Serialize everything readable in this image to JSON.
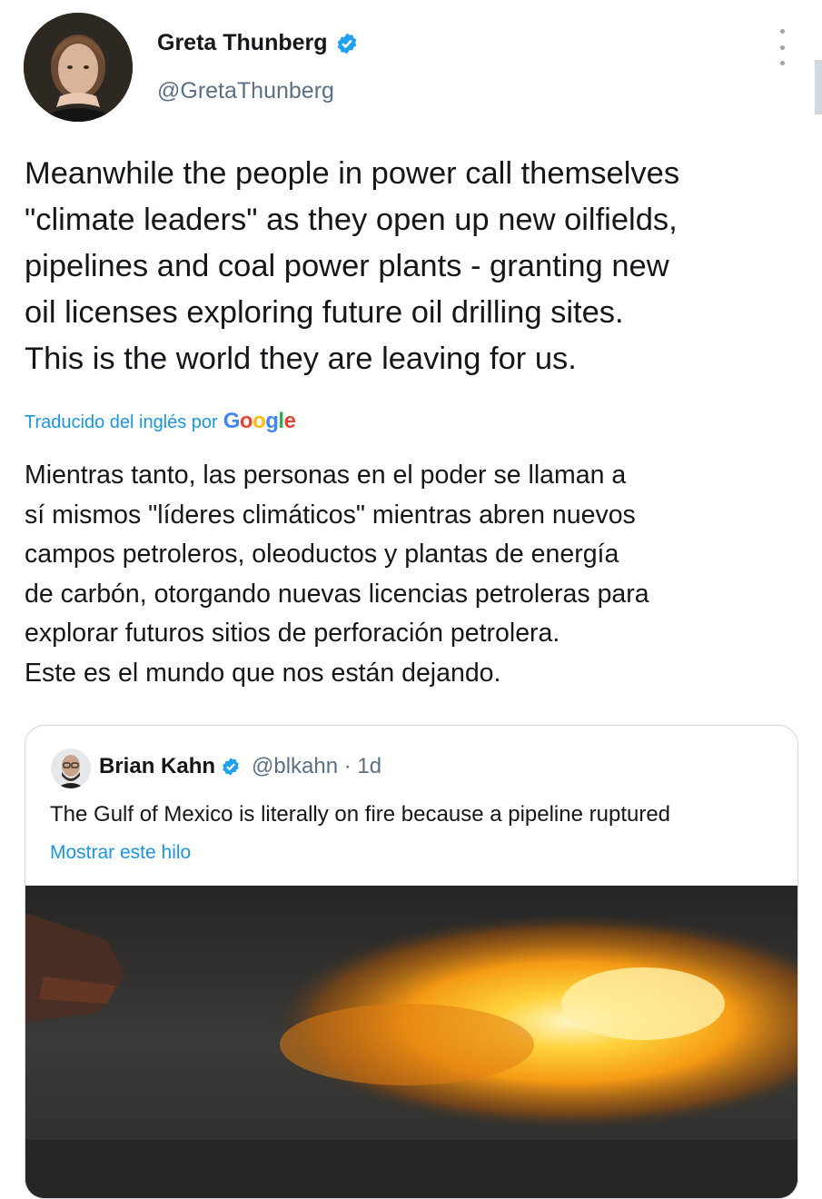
{
  "author": {
    "name": "Greta Thunberg",
    "handle": "@GretaThunberg",
    "verified_icon": "verified-badge-icon"
  },
  "menu_icon": "more-vertical-icon",
  "tweet": {
    "text": "Meanwhile the people in power call themselves\n\"climate leaders\" as they open up new oilfields,\npipelines and coal power plants - granting new\noil licenses exploring future oil drilling sites.\nThis is the world they are leaving for us."
  },
  "translation": {
    "label": "Traducido del inglés por",
    "provider": "Google",
    "text": "Mientras tanto, las personas en el poder se llaman a\nsí mismos \"líderes climáticos\" mientras abren nuevos\ncampos petroleros, oleoductos y plantas de energía\nde carbón, otorgando nuevas licencias petroleras para\nexplorar futuros sitios de perforación petrolera.\n Este es el mundo que nos están dejando."
  },
  "quoted_tweet": {
    "name": "Brian Kahn",
    "handle": "@blkahn · 1d",
    "text": "The Gulf of Mexico is literally on fire because a pipeline ruptured",
    "show_thread_label": "Mostrar este hilo"
  },
  "colors": {
    "link": "#1b95e0",
    "verified": "#1da1f2",
    "secondary_text": "#5b7083"
  }
}
